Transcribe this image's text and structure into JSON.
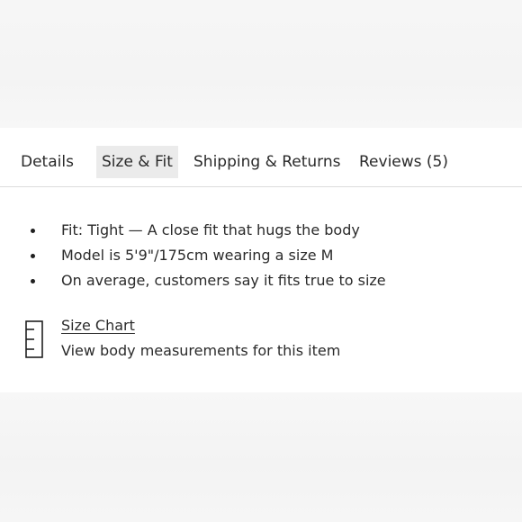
{
  "tabs": [
    {
      "label": "Details"
    },
    {
      "label": "Size & Fit"
    },
    {
      "label": "Shipping & Returns"
    },
    {
      "label": "Reviews (5)"
    }
  ],
  "active_tab": "Size & Fit",
  "fit_details": [
    {
      "text": "Fit: Tight — A close fit that hugs the body"
    },
    {
      "text": "Model is 5'9\"/175cm wearing a size M"
    },
    {
      "text": "On average, customers say it fits true to size"
    }
  ],
  "size_chart": {
    "icon": "ruler-icon",
    "link_label": "Size Chart",
    "description": "View body measurements for this item"
  },
  "colors": {
    "active_tab_bg": "#ebebeb",
    "text": "#2a2a2a",
    "divider": "#dcdcdc"
  }
}
